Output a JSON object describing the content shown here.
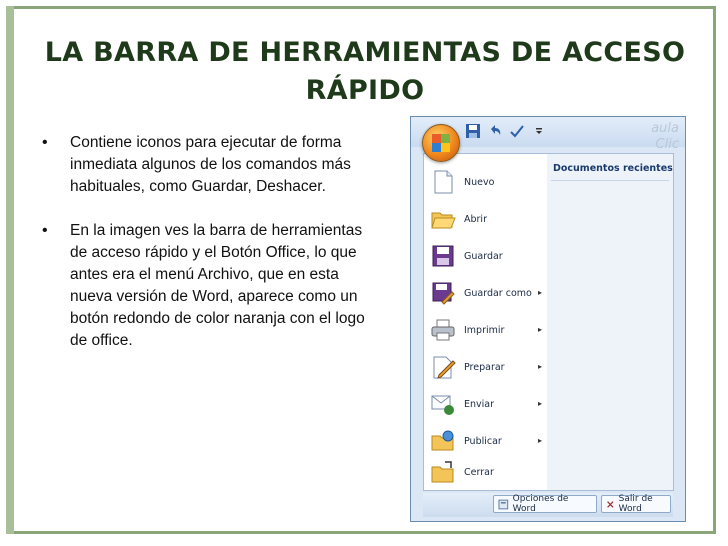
{
  "slide": {
    "title_line1": "LA BARRA DE HERRAMIENTAS DE ACCESO",
    "title_line2": "RÁPIDO",
    "bullets": [
      "Contiene iconos para ejecutar de forma inmediata algunos de los comandos más habituales, como Guardar, Deshacer.",
      "En la imagen ves la barra de herramientas de acceso rápido y el Botón Office, lo que antes era el menú Archivo, que en esta nueva versión de Word, aparece como un botón redondo de color naranja con el logo de office."
    ],
    "bullet_symbol": "•"
  },
  "office_menu": {
    "qat_icons": [
      "save-icon",
      "undo-icon",
      "spell-check-icon",
      "customize-arrow-icon"
    ],
    "watermark_line1": "aula",
    "watermark_line2": "Clic",
    "recent_title": "Documentos recientes",
    "items": [
      {
        "label": "Nuevo",
        "icon": "new-document-icon",
        "submenu": false
      },
      {
        "label": "Abrir",
        "icon": "open-folder-icon",
        "submenu": false
      },
      {
        "label": "Guardar",
        "icon": "save-disk-icon",
        "submenu": false
      },
      {
        "label": "Guardar como",
        "icon": "save-as-icon",
        "submenu": true
      },
      {
        "label": "Imprimir",
        "icon": "printer-icon",
        "submenu": true
      },
      {
        "label": "Preparar",
        "icon": "prepare-pencil-icon",
        "submenu": true
      },
      {
        "label": "Enviar",
        "icon": "send-icon",
        "submenu": true
      },
      {
        "label": "Publicar",
        "icon": "publish-folder-icon",
        "submenu": true
      },
      {
        "label": "Cerrar",
        "icon": "close-folder-icon",
        "submenu": false
      }
    ],
    "submenu_arrow": "▸",
    "word_options_label": "Opciones de Word",
    "exit_word_label": "Salir de Word"
  },
  "colors": {
    "office_button": "#f0861c",
    "frame": "#8aa57a",
    "title": "#1f3a1a"
  }
}
